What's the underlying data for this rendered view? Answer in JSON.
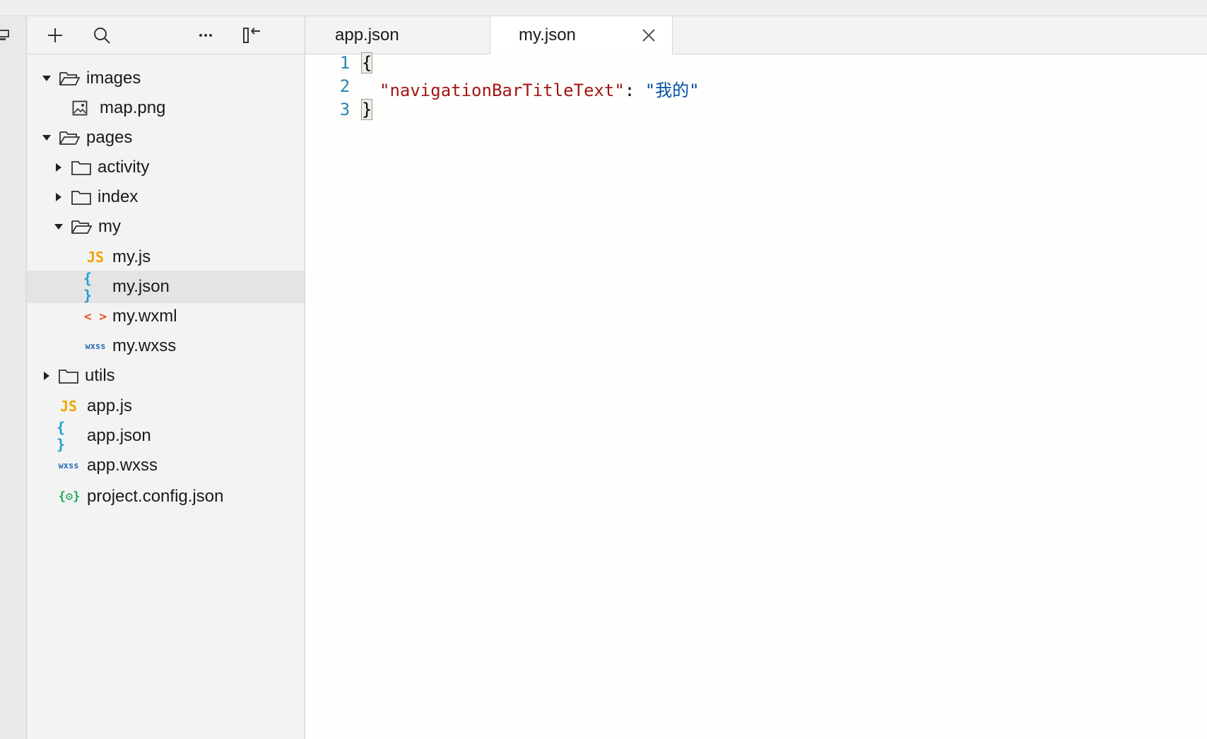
{
  "colors": {
    "js_icon": "#f0a500",
    "json_icon": "#1e9bd7",
    "wxml_icon": "#e8502a",
    "wxss_icon": "#2b6fb6",
    "config_icon": "#1aad5a",
    "line_number": "#2a86b8",
    "json_key": "#a31515",
    "json_string": "#0451a5",
    "selected_row": "#e4e4e4"
  },
  "sidebar": {
    "toolbar": {
      "add_icon": "plus-icon",
      "search_icon": "search-icon",
      "more_icon": "ellipsis-icon",
      "collapse_icon": "collapse-panel-icon"
    },
    "tree": [
      {
        "label": "images",
        "type": "folder",
        "expanded": true
      },
      {
        "label": "map.png",
        "type": "image"
      },
      {
        "label": "pages",
        "type": "folder",
        "expanded": true
      },
      {
        "label": "activity",
        "type": "folder",
        "expanded": false
      },
      {
        "label": "index",
        "type": "folder",
        "expanded": false
      },
      {
        "label": "my",
        "type": "folder",
        "expanded": true
      },
      {
        "label": "my.js",
        "type": "js",
        "icon_text": "JS"
      },
      {
        "label": "my.json",
        "type": "json",
        "icon_text": "{ }",
        "selected": true
      },
      {
        "label": "my.wxml",
        "type": "wxml",
        "icon_text": "< >"
      },
      {
        "label": "my.wxss",
        "type": "wxss",
        "icon_text": "wxss"
      },
      {
        "label": "utils",
        "type": "folder",
        "expanded": false
      },
      {
        "label": "app.js",
        "type": "js",
        "icon_text": "JS"
      },
      {
        "label": "app.json",
        "type": "json",
        "icon_text": "{ }"
      },
      {
        "label": "app.wxss",
        "type": "wxss",
        "icon_text": "wxss"
      },
      {
        "label": "project.config.json",
        "type": "config",
        "icon_text": "{⚙}"
      }
    ]
  },
  "editor": {
    "tabs": [
      {
        "label": "app.json",
        "active": false
      },
      {
        "label": "my.json",
        "active": true
      }
    ],
    "line_numbers": [
      "1",
      "2",
      "3"
    ],
    "code": {
      "open_brace": "{",
      "key": "\"navigationBarTitleText\"",
      "colon": ": ",
      "value": "\"我的\"",
      "close_brace": "}"
    }
  }
}
